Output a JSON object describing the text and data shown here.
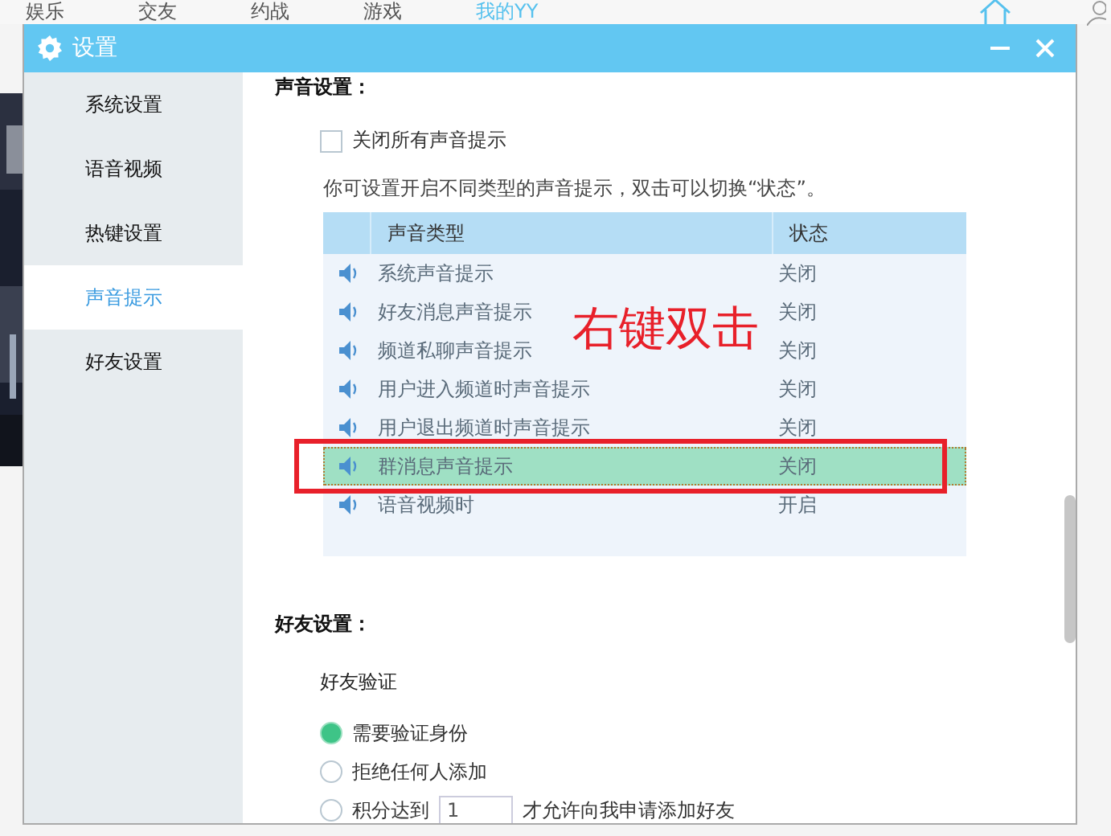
{
  "app_nav": [
    {
      "label": "娱乐",
      "selected": false
    },
    {
      "label": "交友",
      "selected": false
    },
    {
      "label": "约战",
      "selected": false
    },
    {
      "label": "游戏",
      "selected": false
    },
    {
      "label": "我的YY",
      "selected": true
    }
  ],
  "window": {
    "title": "设置"
  },
  "sidebar": {
    "items": [
      {
        "label": "系统设置",
        "selected": false
      },
      {
        "label": "语音视频",
        "selected": false
      },
      {
        "label": "热键设置",
        "selected": false
      },
      {
        "label": "声音提示",
        "selected": true
      },
      {
        "label": "好友设置",
        "selected": false
      }
    ]
  },
  "sound_settings": {
    "heading": "声音设置：",
    "mute_all": {
      "label": "关闭所有声音提示",
      "checked": false
    },
    "hint": "你可设置开启不同类型的声音提示，双击可以切换“状态”。",
    "table": {
      "columns": [
        "声音类型",
        "状态"
      ],
      "rows": [
        {
          "type": "系统声音提示",
          "status": "关闭",
          "selected": false
        },
        {
          "type": "好友消息声音提示",
          "status": "关闭",
          "selected": false
        },
        {
          "type": "频道私聊声音提示",
          "status": "关闭",
          "selected": false
        },
        {
          "type": "用户进入频道时声音提示",
          "status": "关闭",
          "selected": false
        },
        {
          "type": "用户退出频道时声音提示",
          "status": "关闭",
          "selected": false
        },
        {
          "type": "群消息声音提示",
          "status": "关闭",
          "selected": true
        },
        {
          "type": "语音视频时",
          "status": "开启",
          "selected": false
        }
      ]
    }
  },
  "friend_settings": {
    "heading": "好友设置：",
    "subheading": "好友验证",
    "options": [
      {
        "kind": "plain",
        "label": "需要验证身份",
        "selected": true
      },
      {
        "kind": "plain",
        "label": "拒绝任何人添加",
        "selected": false
      },
      {
        "kind": "score",
        "label": "积分达到",
        "value": "1",
        "suffix": "才允许向我申请添加好友",
        "selected": false
      }
    ]
  },
  "annotation": {
    "text": "右键双击"
  }
}
